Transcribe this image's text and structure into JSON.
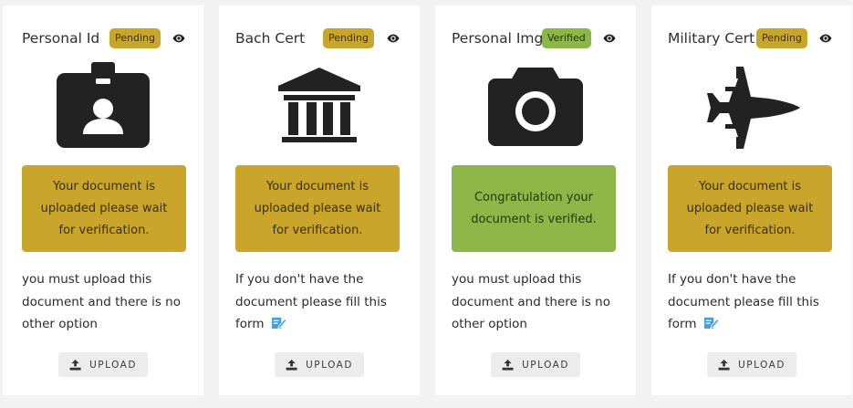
{
  "cards": [
    {
      "title": "Personal Id",
      "status": "Pending",
      "icon": "id-badge-icon",
      "notice": "Your document is uploaded please wait for verification.",
      "description": "you must upload this document and there is no other option",
      "upload_label": "UPLOAD"
    },
    {
      "title": "Bach Cert",
      "status": "Pending",
      "icon": "bank-building-icon",
      "notice": "Your document is uploaded please wait for verification.",
      "description": "If you don't have the document please fill this form",
      "form_link_icon": "edit-form-icon",
      "upload_label": "UPLOAD"
    },
    {
      "title": "Personal Img",
      "status": "Verified",
      "icon": "camera-icon",
      "notice": "Congratulation your document is verified.",
      "description": "you must upload this document and there is no other option",
      "upload_label": "UPLOAD"
    },
    {
      "title": "Military Cert",
      "status": "Pending",
      "icon": "fighter-jet-icon",
      "notice": "Your document is uploaded please wait for verification.",
      "description": "If you don't have the document please fill this form",
      "form_link_icon": "edit-form-icon",
      "upload_label": "UPLOAD"
    }
  ],
  "colors": {
    "pending": "#c9a52c",
    "verified": "#8db648",
    "icon": "#222222",
    "link_icon": "#4a9fd8"
  }
}
